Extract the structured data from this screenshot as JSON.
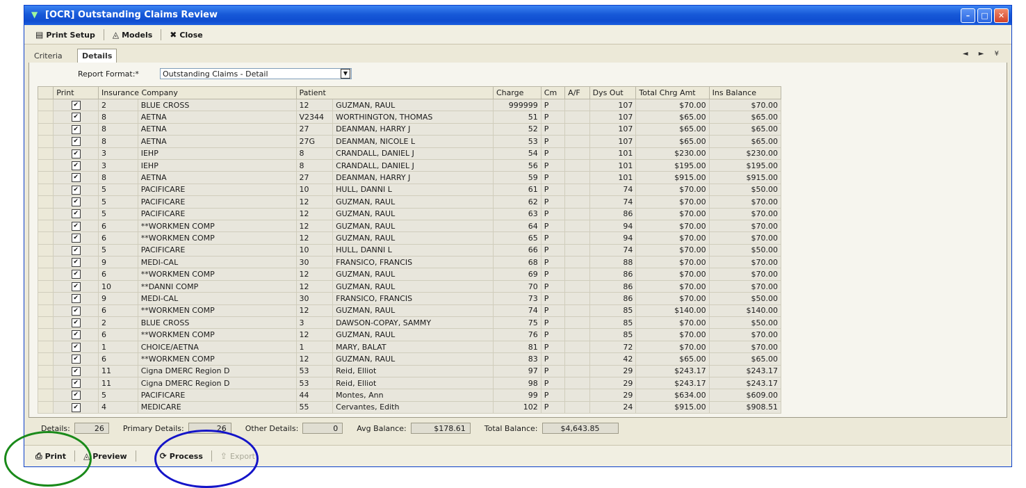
{
  "window": {
    "title": "[OCR] Outstanding Claims Review",
    "minimize": "–",
    "maximize": "□",
    "close": "✕"
  },
  "toolbar": {
    "print_setup": "Print Setup",
    "models": "Models",
    "close": "Close"
  },
  "tabs": [
    {
      "label": "Criteria"
    },
    {
      "label": "Details"
    }
  ],
  "tab_nav": "◄ ► ¥",
  "report_format": {
    "label": "Report Format:*",
    "value": "Outstanding Claims - Detail"
  },
  "table": {
    "headers": [
      "Print",
      "Insurance Company",
      "",
      "Patient",
      "",
      "Charge",
      "Cm",
      "A/F",
      "Dys Out",
      "Total Chrg Amt",
      "Ins Balance"
    ],
    "rows": [
      [
        "✔",
        "2",
        "BLUE CROSS",
        "12",
        "GUZMAN, RAUL",
        "999999",
        "P",
        "",
        "107",
        "$70.00",
        "$70.00"
      ],
      [
        "✔",
        "8",
        "AETNA",
        "V2344",
        "WORTHINGTON, THOMAS",
        "51",
        "P",
        "",
        "107",
        "$65.00",
        "$65.00"
      ],
      [
        "✔",
        "8",
        "AETNA",
        "27",
        "DEANMAN, HARRY J",
        "52",
        "P",
        "",
        "107",
        "$65.00",
        "$65.00"
      ],
      [
        "✔",
        "8",
        "AETNA",
        "27G",
        "DEANMAN, NICOLE L",
        "53",
        "P",
        "",
        "107",
        "$65.00",
        "$65.00"
      ],
      [
        "✔",
        "3",
        "IEHP",
        "8",
        "CRANDALL, DANIEL J",
        "54",
        "P",
        "",
        "101",
        "$230.00",
        "$230.00"
      ],
      [
        "✔",
        "3",
        "IEHP",
        "8",
        "CRANDALL, DANIEL J",
        "56",
        "P",
        "",
        "101",
        "$195.00",
        "$195.00"
      ],
      [
        "✔",
        "8",
        "AETNA",
        "27",
        "DEANMAN, HARRY J",
        "59",
        "P",
        "",
        "101",
        "$915.00",
        "$915.00"
      ],
      [
        "✔",
        "5",
        "PACIFICARE",
        "10",
        "HULL, DANNI L",
        "61",
        "P",
        "",
        "74",
        "$70.00",
        "$50.00"
      ],
      [
        "✔",
        "5",
        "PACIFICARE",
        "12",
        "GUZMAN, RAUL",
        "62",
        "P",
        "",
        "74",
        "$70.00",
        "$70.00"
      ],
      [
        "✔",
        "5",
        "PACIFICARE",
        "12",
        "GUZMAN, RAUL",
        "63",
        "P",
        "",
        "86",
        "$70.00",
        "$70.00"
      ],
      [
        "✔",
        "6",
        "**WORKMEN COMP",
        "12",
        "GUZMAN, RAUL",
        "64",
        "P",
        "",
        "94",
        "$70.00",
        "$70.00"
      ],
      [
        "✔",
        "6",
        "**WORKMEN COMP",
        "12",
        "GUZMAN, RAUL",
        "65",
        "P",
        "",
        "94",
        "$70.00",
        "$70.00"
      ],
      [
        "✔",
        "5",
        "PACIFICARE",
        "10",
        "HULL, DANNI L",
        "66",
        "P",
        "",
        "74",
        "$70.00",
        "$50.00"
      ],
      [
        "✔",
        "9",
        "MEDI-CAL",
        "30",
        "FRANSICO, FRANCIS",
        "68",
        "P",
        "",
        "88",
        "$70.00",
        "$70.00"
      ],
      [
        "✔",
        "6",
        "**WORKMEN COMP",
        "12",
        "GUZMAN, RAUL",
        "69",
        "P",
        "",
        "86",
        "$70.00",
        "$70.00"
      ],
      [
        "✔",
        "10",
        "**DANNI COMP",
        "12",
        "GUZMAN, RAUL",
        "70",
        "P",
        "",
        "86",
        "$70.00",
        "$70.00"
      ],
      [
        "✔",
        "9",
        "MEDI-CAL",
        "30",
        "FRANSICO, FRANCIS",
        "73",
        "P",
        "",
        "86",
        "$70.00",
        "$50.00"
      ],
      [
        "✔",
        "6",
        "**WORKMEN COMP",
        "12",
        "GUZMAN, RAUL",
        "74",
        "P",
        "",
        "85",
        "$140.00",
        "$140.00"
      ],
      [
        "✔",
        "2",
        "BLUE CROSS",
        "3",
        "DAWSON-COPAY, SAMMY",
        "75",
        "P",
        "",
        "85",
        "$70.00",
        "$50.00"
      ],
      [
        "✔",
        "6",
        "**WORKMEN COMP",
        "12",
        "GUZMAN, RAUL",
        "76",
        "P",
        "",
        "85",
        "$70.00",
        "$70.00"
      ],
      [
        "✔",
        "1",
        "CHOICE/AETNA",
        "1",
        "MARY, BALAT",
        "81",
        "P",
        "",
        "72",
        "$70.00",
        "$70.00"
      ],
      [
        "✔",
        "6",
        "**WORKMEN COMP",
        "12",
        "GUZMAN, RAUL",
        "83",
        "P",
        "",
        "42",
        "$65.00",
        "$65.00"
      ],
      [
        "✔",
        "11",
        "Cigna DMERC Region D",
        "53",
        "Reid, Elliot",
        "97",
        "P",
        "",
        "29",
        "$243.17",
        "$243.17"
      ],
      [
        "✔",
        "11",
        "Cigna DMERC Region D",
        "53",
        "Reid, Elliot",
        "98",
        "P",
        "",
        "29",
        "$243.17",
        "$243.17"
      ],
      [
        "✔",
        "5",
        "PACIFICARE",
        "44",
        "Montes, Ann",
        "99",
        "P",
        "",
        "29",
        "$634.00",
        "$609.00"
      ],
      [
        "✔",
        "4",
        "MEDICARE",
        "55",
        "Cervantes, Edith",
        "102",
        "P",
        "",
        "24",
        "$915.00",
        "$908.51"
      ]
    ]
  },
  "summary": {
    "details_label": "Details:",
    "details_value": "26",
    "primary_label": "Primary Details:",
    "primary_value": "26",
    "other_label": "Other Details:",
    "other_value": "0",
    "avg_label": "Avg Balance:",
    "avg_value": "$178.61",
    "total_label": "Total Balance:",
    "total_value": "$4,643.85"
  },
  "bottom": {
    "print": "Print",
    "preview": "Preview",
    "process": "Process",
    "export": "Export"
  },
  "colors": {
    "highlight_print": "#1a8a1a",
    "highlight_process": "#1414c8",
    "title_bar": "#1759d8"
  }
}
